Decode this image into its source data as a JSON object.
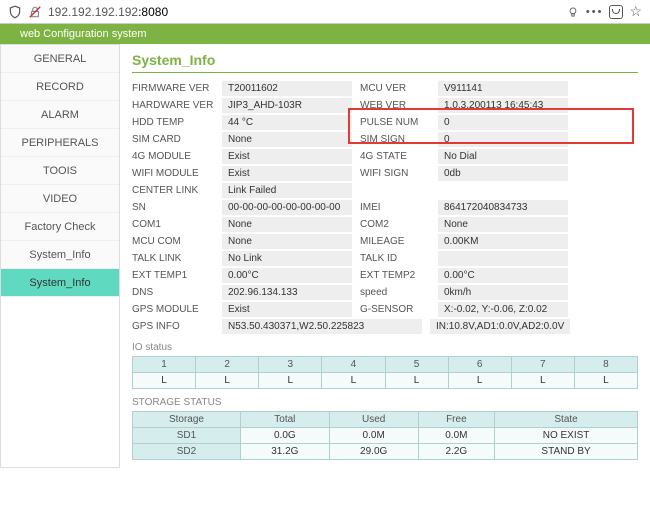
{
  "browser": {
    "url_prefix": "192.192.192.192",
    "url_port": ":8080"
  },
  "banner": {
    "title": "web Configuration system"
  },
  "sidebar": {
    "items": [
      {
        "label": "GENERAL"
      },
      {
        "label": "RECORD"
      },
      {
        "label": "ALARM"
      },
      {
        "label": "PERIPHERALS"
      },
      {
        "label": "TOOIS"
      },
      {
        "label": "VIDEO"
      },
      {
        "label": "Factory Check"
      },
      {
        "label": "System_Info"
      },
      {
        "label": "System_Info"
      }
    ]
  },
  "main": {
    "title": "System_Info",
    "rows": [
      {
        "l1": "FIRMWARE VER",
        "v1": "T20011602",
        "l2": "MCU VER",
        "v2": "V911141"
      },
      {
        "l1": "HARDWARE VER",
        "v1": "JIP3_AHD-103R",
        "l2": "WEB VER",
        "v2": "1.0.3,200113 16:45:43"
      },
      {
        "l1": "HDD TEMP",
        "v1": "44 °C",
        "l2": "PULSE NUM",
        "v2": "0"
      },
      {
        "l1": "SIM CARD",
        "v1": "None",
        "l2": "SIM SIGN",
        "v2": "0"
      },
      {
        "l1": "4G MODULE",
        "v1": "Exist",
        "l2": "4G STATE",
        "v2": "No Dial"
      },
      {
        "l1": "WIFI MODULE",
        "v1": "Exist",
        "l2": "WIFI SIGN",
        "v2": "0db"
      },
      {
        "l1": "CENTER LINK",
        "v1": "Link Failed",
        "l2": "",
        "v2": ""
      },
      {
        "l1": "SN",
        "v1": "00-00-00-00-00-00-00-00",
        "l2": "IMEI",
        "v2": "864172040834733"
      },
      {
        "l1": "COM1",
        "v1": "None",
        "l2": "COM2",
        "v2": "None"
      },
      {
        "l1": "MCU COM",
        "v1": "None",
        "l2": "MILEAGE",
        "v2": "0.00KM"
      },
      {
        "l1": "TALK LINK",
        "v1": "No Link",
        "l2": "TALK ID",
        "v2": ""
      },
      {
        "l1": "EXT TEMP1",
        "v1": "0.00°C",
        "l2": "EXT TEMP2",
        "v2": "0.00°C"
      },
      {
        "l1": "DNS",
        "v1": "202.96.134.133",
        "l2": "speed",
        "v2": "0km/h"
      },
      {
        "l1": "GPS MODULE",
        "v1": "Exist",
        "l2": "G-SENSOR",
        "v2": "X:-0.02, Y:-0.06, Z:0.02"
      }
    ],
    "gps_label": "GPS INFO",
    "gps_left": "N53.50.430371,W2.50.225823",
    "gps_right": "IN:10.8V,AD1:0.0V,AD2:0.0V",
    "io_label": "IO status",
    "io": {
      "headers": [
        "1",
        "2",
        "3",
        "4",
        "5",
        "6",
        "7",
        "8"
      ],
      "values": [
        "L",
        "L",
        "L",
        "L",
        "L",
        "L",
        "L",
        "L"
      ]
    },
    "storage_label": "STORAGE STATUS",
    "storage": {
      "headers": [
        "Storage",
        "Total",
        "Used",
        "Free",
        "State"
      ],
      "rows": [
        {
          "c0": "SD1",
          "c1": "0.0G",
          "c2": "0.0M",
          "c3": "0.0M",
          "c4": "NO EXIST"
        },
        {
          "c0": "SD2",
          "c1": "31.2G",
          "c2": "29.0G",
          "c3": "2.2G",
          "c4": "STAND BY"
        }
      ]
    }
  }
}
